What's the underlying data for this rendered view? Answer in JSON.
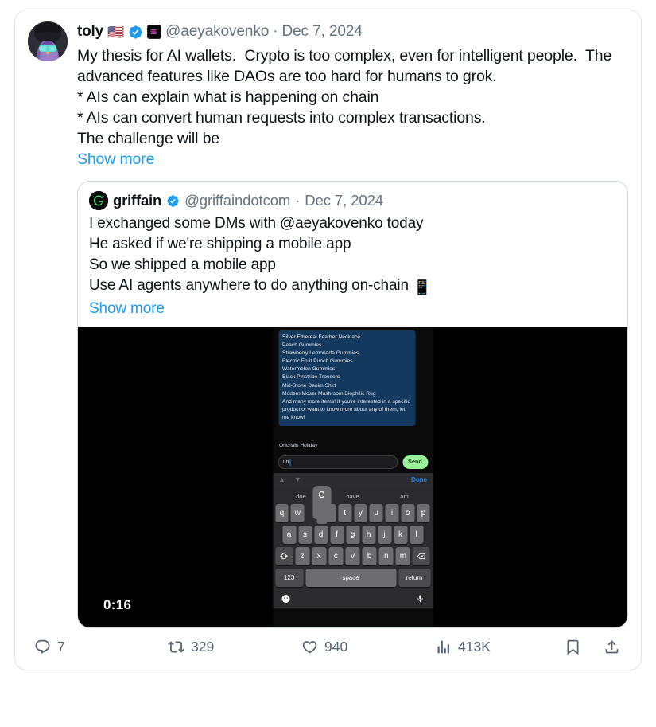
{
  "tweet": {
    "author": {
      "display_name": "toly",
      "flag": "🇺🇸",
      "handle": "@aeyakovenko",
      "separator": "·",
      "date": "Dec 7, 2024",
      "verified_icon": "verified-badge-icon",
      "affiliate_icon": "solana-badge-icon",
      "avatar_icon": "toly-avatar"
    },
    "body": "My thesis for AI wallets.  Crypto is too complex, even for intelligent people.  The advanced features like DAOs are too hard for humans to grok.\n* AIs can explain what is happening on chain\n* AIs can convert human requests into complex transactions.\nThe challenge will be",
    "show_more": "Show more"
  },
  "quoted_tweet": {
    "author": {
      "display_name": "griffain",
      "handle": "@griffaindotcom",
      "separator": "·",
      "date": "Dec 7, 2024",
      "verified_icon": "verified-badge-icon",
      "avatar_icon": "griffain-logo"
    },
    "body": "I exchanged some DMs with @aeyakovenko today\nHe asked if we're shipping a mobile app\nSo we shipped a mobile app\nUse AI agents anywhere to do anything on-chain ",
    "body_emoji": "📱",
    "show_more": "Show more",
    "video": {
      "duration": "0:16",
      "chat_message_lines": [
        "Silver Ethereal Feather Necklace",
        "Peach Gummies",
        "Strawberry Lemonade Gummies",
        "Electric Fruit Punch Gummies",
        "Watermelon Gummies",
        "Black Pinstripe Trousers",
        "Mid-Stone Denim Shirt",
        "Modern Moser Mushroom Biophilic Rug"
      ],
      "chat_message_tail": "And many more items! If you're interested in a specific product or want to know more about any of them, let me know!",
      "chat_caption": "Onchain Holiday",
      "input_value": "i n",
      "send_label": "Send",
      "done_label": "Done",
      "suggestions": [
        "doe",
        "have",
        "am"
      ],
      "key_popup": "e",
      "keyboard_row1": [
        "q",
        "w",
        "e",
        "r",
        "t",
        "y",
        "u",
        "i",
        "o",
        "p"
      ],
      "keyboard_row2": [
        "a",
        "s",
        "d",
        "f",
        "g",
        "h",
        "j",
        "k",
        "l"
      ],
      "keyboard_row3": [
        "z",
        "x",
        "c",
        "v",
        "b",
        "n",
        "m"
      ],
      "shift_icon": "shift-icon",
      "backspace_icon": "backspace-icon",
      "numbers_key": "123",
      "space_key": "space",
      "return_key": "return",
      "emoji_key_icon": "emoji-icon",
      "mic_key_icon": "microphone-icon"
    }
  },
  "actions": {
    "reply": {
      "icon": "reply-icon",
      "count": "7"
    },
    "retweet": {
      "icon": "retweet-icon",
      "count": "329"
    },
    "like": {
      "icon": "heart-icon",
      "count": "940"
    },
    "views": {
      "icon": "analytics-icon",
      "count": "413K"
    },
    "bookmark": {
      "icon": "bookmark-icon"
    },
    "share": {
      "icon": "share-icon"
    }
  },
  "colors": {
    "link": "#1d9bf0",
    "verified": "#1d9bf0",
    "muted": "#64747f",
    "text": "#0f1419",
    "card_border": "#e3e6e8",
    "send_button": "#9af29a",
    "chat_bubble": "#133a5e"
  }
}
